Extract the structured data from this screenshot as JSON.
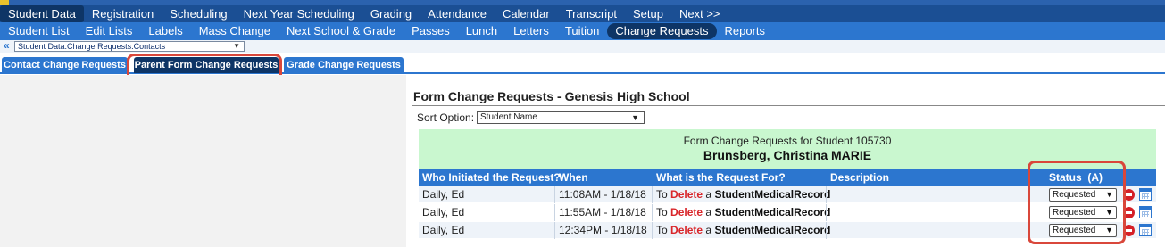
{
  "nav_primary": [
    "Student Data",
    "Registration",
    "Scheduling",
    "Next Year Scheduling",
    "Grading",
    "Attendance",
    "Calendar",
    "Transcript",
    "Setup",
    "Next >>"
  ],
  "nav_secondary": [
    "Student List",
    "Edit Lists",
    "Labels",
    "Mass Change",
    "Next School & Grade",
    "Passes",
    "Lunch",
    "Letters",
    "Tuition",
    "Change Requests",
    "Reports"
  ],
  "context": {
    "chevron": "«",
    "selector": "Student Data.Change Requests.Contacts"
  },
  "tabs": [
    "Contact Change Requests",
    "Parent Form Change Requests",
    "Grade Change Requests"
  ],
  "page_title": "Form Change Requests - Genesis High School",
  "sort": {
    "label": "Sort Option:",
    "value": "Student Name"
  },
  "student_panel": {
    "subtitle": "Form Change Requests for Student 105730",
    "name": "Brunsberg, Christina MARIE"
  },
  "columns": [
    "Who Initiated the Request?",
    "When",
    "What is the Request For?",
    "Description",
    "Status  (A)"
  ],
  "rows": [
    {
      "who": "Daily, Ed",
      "when": "11:08AM - 1/18/18",
      "to": "To",
      "action": "Delete",
      "a": "a",
      "record": "StudentMedicalRecord",
      "description": "",
      "status": "Requested"
    },
    {
      "who": "Daily, Ed",
      "when": "11:55AM - 1/18/18",
      "to": "To",
      "action": "Delete",
      "a": "a",
      "record": "StudentMedicalRecord",
      "description": "",
      "status": "Requested"
    },
    {
      "who": "Daily, Ed",
      "when": "12:34PM - 1/18/18",
      "to": "To",
      "action": "Delete",
      "a": "a",
      "record": "StudentMedicalRecord",
      "description": "",
      "status": "Requested"
    }
  ],
  "colors": {
    "nav_dark": "#1b4f94",
    "nav_blue": "#2c76cf",
    "active_tab": "#0e3566",
    "panel_green": "#c9f7cf",
    "highlight_ring": "#d9473b",
    "delete_red": "#d9262a"
  }
}
